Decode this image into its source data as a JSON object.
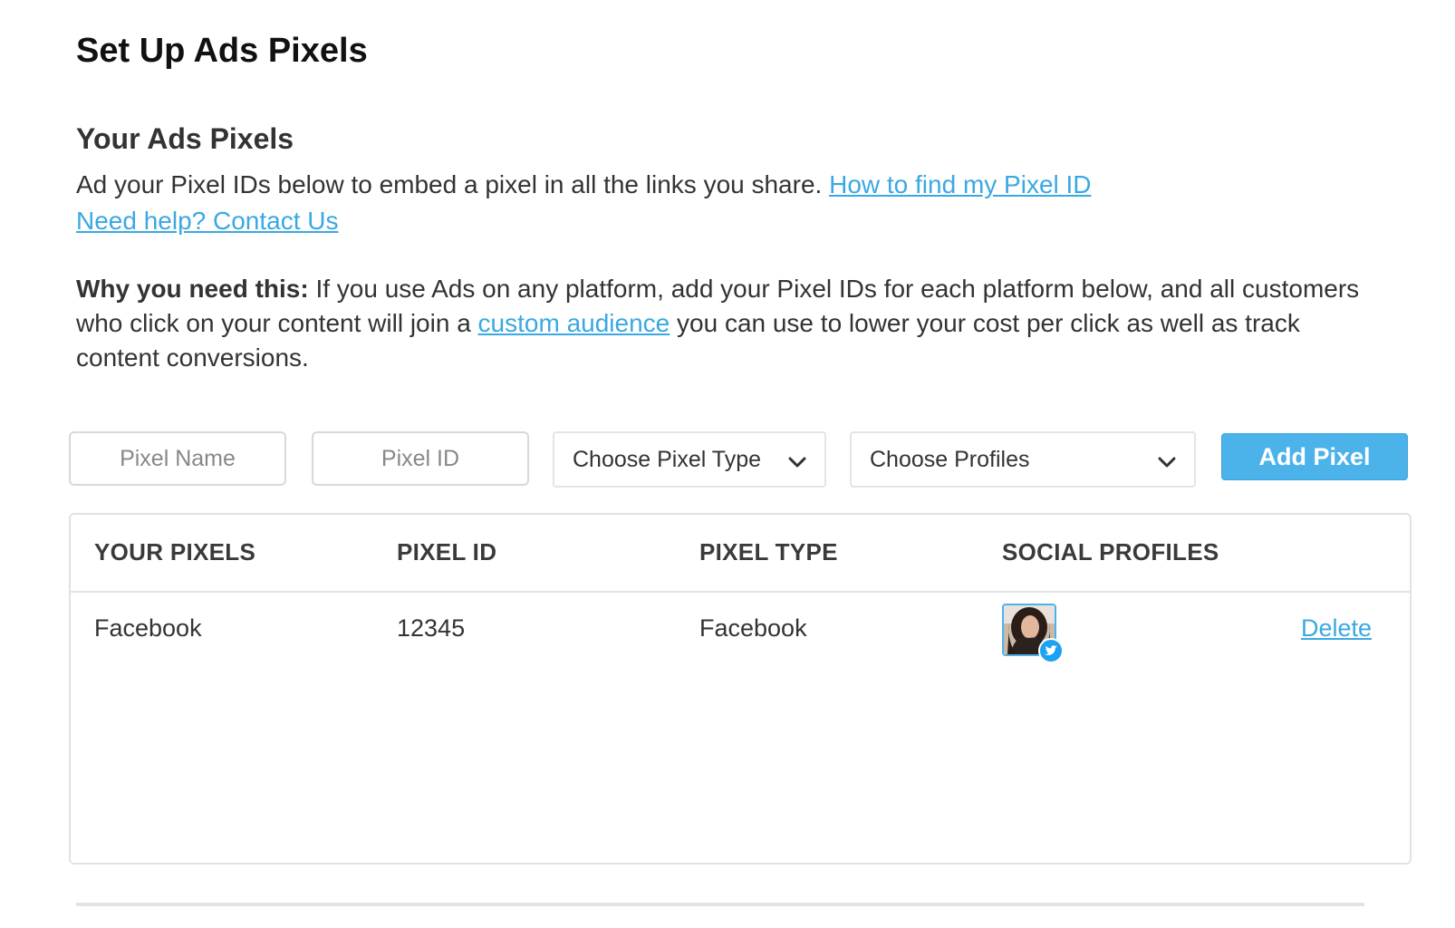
{
  "page": {
    "title": "Set Up Ads Pixels"
  },
  "section": {
    "title": "Your Ads Pixels",
    "intro_text": "Ad your Pixel IDs below to embed a pixel in all the links you share.",
    "find_pixel_link": "How to find my Pixel ID",
    "help_link": "Need help? Contact Us"
  },
  "why": {
    "label": "Why you need this:",
    "text_before": "If you use Ads on any platform, add your Pixel IDs for each platform below, and all customers who click on your content will join a",
    "link": "custom audience",
    "text_after": "you can use to lower your cost per click as well as track content conversions."
  },
  "form": {
    "pixel_name_placeholder": "Pixel Name",
    "pixel_name_value": "",
    "pixel_id_placeholder": "Pixel ID",
    "pixel_id_value": "",
    "pixel_type_selected": "Choose Pixel Type",
    "profiles_selected": "Choose Profiles",
    "add_button": "Add Pixel"
  },
  "table": {
    "headers": [
      "YOUR PIXELS",
      "PIXEL ID",
      "PIXEL TYPE",
      "SOCIAL PROFILES"
    ],
    "rows": [
      {
        "name": "Facebook",
        "pixel_id": "12345",
        "pixel_type": "Facebook",
        "profile_icon": "twitter-icon",
        "action": "Delete"
      }
    ]
  },
  "colors": {
    "accent": "#4cb3ea",
    "link": "#3aa8e2",
    "border": "#e2e2e2",
    "text": "#333333"
  }
}
